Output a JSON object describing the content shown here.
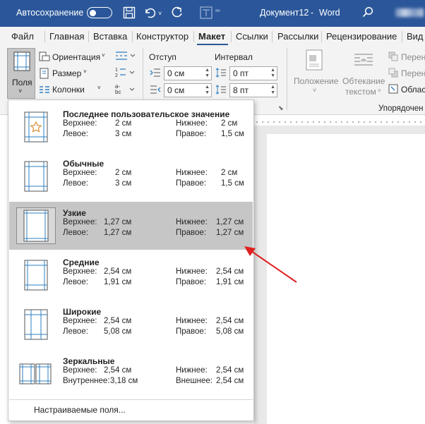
{
  "titlebar": {
    "autosave_label": "Автосохранение",
    "document_title": "Документ12",
    "separator": "-",
    "app_name": "Word"
  },
  "tabs": [
    {
      "label": "Файл",
      "active": false
    },
    {
      "label": "Главная",
      "active": false
    },
    {
      "label": "Вставка",
      "active": false
    },
    {
      "label": "Конструктор",
      "active": false
    },
    {
      "label": "Макет",
      "active": true
    },
    {
      "label": "Ссылки",
      "active": false
    },
    {
      "label": "Рассылки",
      "active": false
    },
    {
      "label": "Рецензирование",
      "active": false
    },
    {
      "label": "Вид",
      "active": false
    }
  ],
  "ribbon": {
    "margins_button": {
      "label": "Поля",
      "chevron": "˅"
    },
    "orientation": "Ориентация",
    "size": "Размер",
    "columns": "Колонки",
    "indent": {
      "title": "Отступ",
      "left_value": "0 см",
      "right_value": "0 см"
    },
    "spacing": {
      "title": "Интервал",
      "before_value": "0 пт",
      "after_value": "8 пт"
    },
    "position": {
      "line1": "Положение",
      "chevron": "˅"
    },
    "wrap_text": {
      "line1": "Обтекание",
      "line2": "текстом"
    },
    "bring_forward": "Перен",
    "send_backward": "Перен",
    "selection_pane": "Облас",
    "arrange_group": "Упорядочен"
  },
  "margins_menu": {
    "items": [
      {
        "title": "Последнее пользовательское значение",
        "top_label": "Верхнее:",
        "top": "2 см",
        "bottom_label": "Нижнее:",
        "bottom": "2 см",
        "left_label": "Левое:",
        "left": "3 см",
        "right_label": "Правое:",
        "right": "1,5 см",
        "icon": "margins-custom-star-icon",
        "selected": false
      },
      {
        "title": "Обычные",
        "top_label": "Верхнее:",
        "top": "2 см",
        "bottom_label": "Нижнее:",
        "bottom": "2 см",
        "left_label": "Левое:",
        "left": "3 см",
        "right_label": "Правое:",
        "right": "1,5 см",
        "icon": "margins-normal-icon",
        "selected": false
      },
      {
        "title": "Узкие",
        "top_label": "Верхнее:",
        "top": "1,27 см",
        "bottom_label": "Нижнее:",
        "bottom": "1,27 см",
        "left_label": "Левое:",
        "left": "1,27 см",
        "right_label": "Правое:",
        "right": "1,27 см",
        "icon": "margins-narrow-icon",
        "selected": true
      },
      {
        "title": "Средние",
        "top_label": "Верхнее:",
        "top": "2,54 см",
        "bottom_label": "Нижнее:",
        "bottom": "2,54 см",
        "left_label": "Левое:",
        "left": "1,91 см",
        "right_label": "Правое:",
        "right": "1,91 см",
        "icon": "margins-moderate-icon",
        "selected": false
      },
      {
        "title": "Широкие",
        "top_label": "Верхнее:",
        "top": "2,54 см",
        "bottom_label": "Нижнее:",
        "bottom": "2,54 см",
        "left_label": "Левое:",
        "left": "5,08 см",
        "right_label": "Правое:",
        "right": "5,08 см",
        "icon": "margins-wide-icon",
        "selected": false
      },
      {
        "title": "Зеркальные",
        "top_label": "Верхнее:",
        "top": "2,54 см",
        "bottom_label": "Нижнее:",
        "bottom": "2,54 см",
        "left_label": "Внутреннее:",
        "left": "3,18 см",
        "right_label": "Внешнее:",
        "right": "2,54 см",
        "icon": "margins-mirrored-icon",
        "selected": false
      }
    ],
    "custom_margins": "Настраиваемые поля..."
  },
  "colors": {
    "title_bar": "#2b579a",
    "annotation_arrow": "#e02020",
    "selected_item": "#c6c6c6"
  }
}
